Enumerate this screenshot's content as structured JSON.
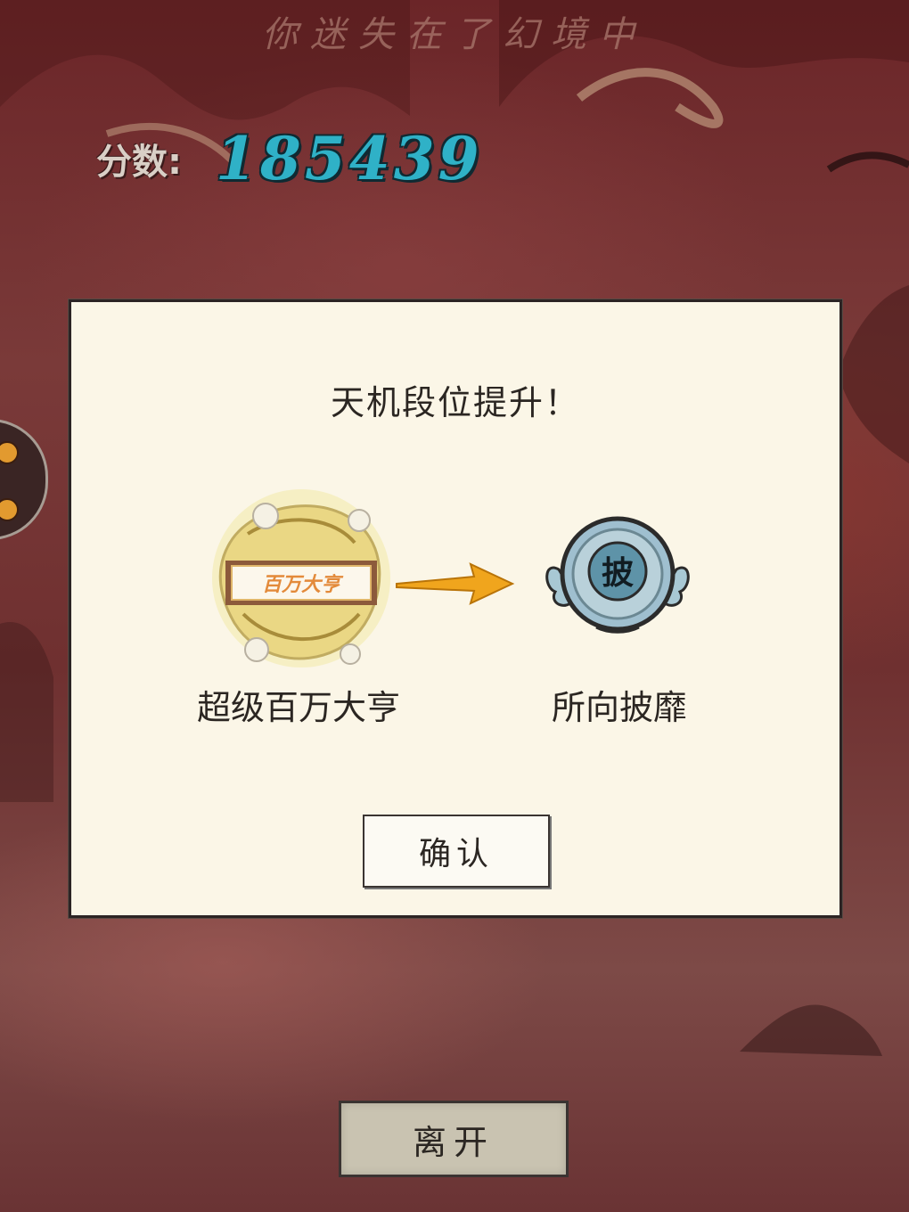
{
  "header": {
    "caption": "你迷失在了幻境中",
    "score_label": "分数:",
    "score_value": "185439"
  },
  "dialog": {
    "title": "天机段位提升！",
    "old_rank": {
      "label": "超级百万大亨",
      "badge_text": "百万大亨",
      "icon": "golden-dragon-emblem"
    },
    "new_rank": {
      "label": "所向披靡",
      "badge_text": "披",
      "icon": "winged-blue-medallion"
    },
    "arrow_icon": "right-arrow",
    "confirm_label": "确认"
  },
  "footer": {
    "leave_label": "离开"
  },
  "colors": {
    "background": "#6e2a2b",
    "dialog_bg": "#fbf6e7",
    "score": "#2fb1c7",
    "arrow": "#f0a51d",
    "medal": "#9fbfcf",
    "leave_button": "#c9c3b1"
  }
}
